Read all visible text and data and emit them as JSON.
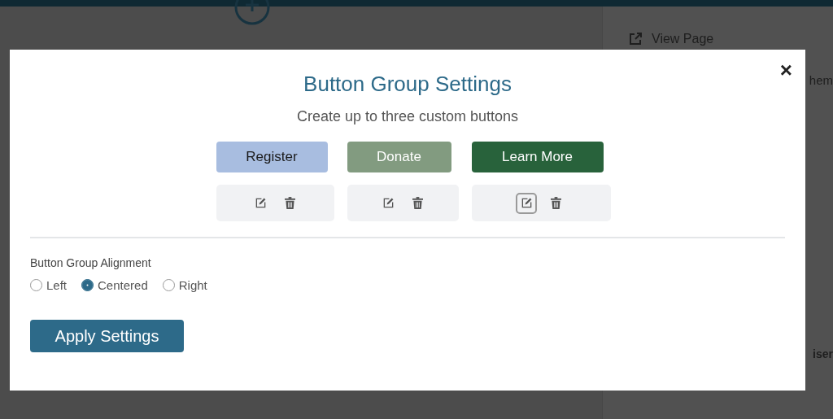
{
  "background": {
    "view_page_link": "View Page",
    "partial_texts": [
      "hem",
      "iser"
    ]
  },
  "modal": {
    "close": "×",
    "title": "Button Group Settings",
    "subtitle": "Create up to three custom buttons",
    "custom_buttons": [
      {
        "label": "Register",
        "color": "#a8bde0",
        "dark_text": true,
        "edit_focused": false
      },
      {
        "label": "Donate",
        "color": "#829b80",
        "dark_text": false,
        "edit_focused": false
      },
      {
        "label": "Learn More",
        "color": "#28623b",
        "dark_text": false,
        "edit_focused": true
      }
    ],
    "alignment_label": "Button Group Alignment",
    "alignment_options": [
      {
        "label": "Left",
        "selected": false
      },
      {
        "label": "Centered",
        "selected": true
      },
      {
        "label": "Right",
        "selected": false
      }
    ],
    "apply_button": "Apply Settings"
  }
}
